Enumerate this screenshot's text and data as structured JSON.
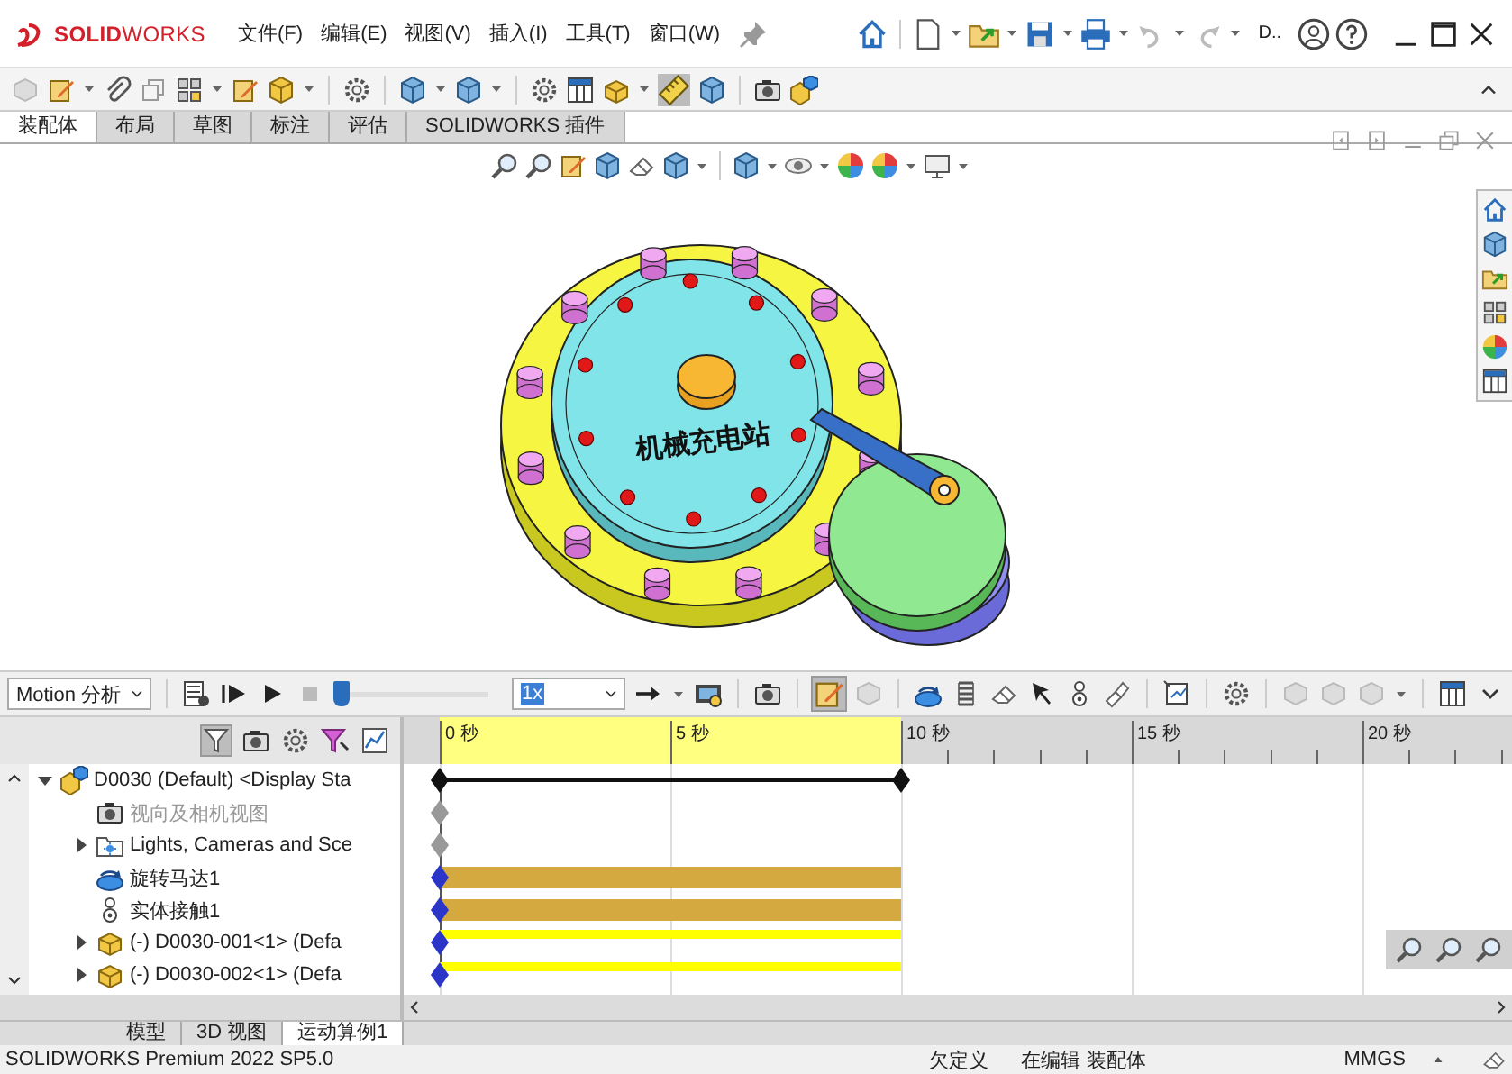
{
  "window": {
    "logo": "**SOLID**WORKS",
    "menus": [
      "文件(F)",
      "编辑(E)",
      "视图(V)",
      "插入(I)",
      "工具(T)",
      "窗口(W)"
    ],
    "document_title": "D.."
  },
  "command_tabs": [
    {
      "label": "装配体",
      "selected": true
    },
    {
      "label": "布局",
      "selected": false
    },
    {
      "label": "草图",
      "selected": false
    },
    {
      "label": "标注",
      "selected": false
    },
    {
      "label": "评估",
      "selected": false
    },
    {
      "label": "SOLIDWORKS 插件",
      "selected": false
    }
  ],
  "model_label": "机械充电站",
  "motion": {
    "study_type": "Motion 分析",
    "slider": {
      "level": 0
    },
    "speed": "1x"
  },
  "timeline": {
    "labels": [
      "0 秒",
      "5 秒",
      "10 秒",
      "15 秒",
      "20 秒"
    ]
  },
  "tree": [
    {
      "label": "D0030 (Default) <Display Sta",
      "kind": "assembly",
      "expanded": true,
      "disabled": false,
      "track": {
        "kind": "span"
      },
      "children": [
        {
          "label": "视向及相机视图",
          "kind": "camera",
          "disabled": true,
          "track": {
            "kind": "key"
          }
        },
        {
          "label": "Lights, Cameras and Sce",
          "kind": "lights",
          "expanded": false,
          "disabled": false,
          "track": {
            "kind": "key"
          }
        },
        {
          "label": "旋转马达1",
          "kind": "motor",
          "disabled": false,
          "track": {
            "kind": "bar"
          }
        },
        {
          "label": "实体接触1",
          "kind": "contact",
          "disabled": false,
          "track": {
            "kind": "bar"
          }
        },
        {
          "label": "(-) D0030-001<1> (Defa",
          "kind": "part",
          "expanded": false,
          "disabled": false,
          "track": {
            "kind": "thin"
          }
        },
        {
          "label": "(-) D0030-002<1> (Defa",
          "kind": "part",
          "expanded": false,
          "disabled": false,
          "track": {
            "kind": "thin"
          }
        }
      ]
    }
  ],
  "bottom_tabs": [
    {
      "label": "模型",
      "selected": false
    },
    {
      "label": "3D 视图",
      "selected": false
    },
    {
      "label": "运动算例1",
      "selected": true
    }
  ],
  "status_bar": {
    "product": "SOLIDWORKS Premium 2022 SP5.0",
    "state": "欠定义",
    "mode": "在编辑 装配体",
    "units": "MMGS"
  }
}
